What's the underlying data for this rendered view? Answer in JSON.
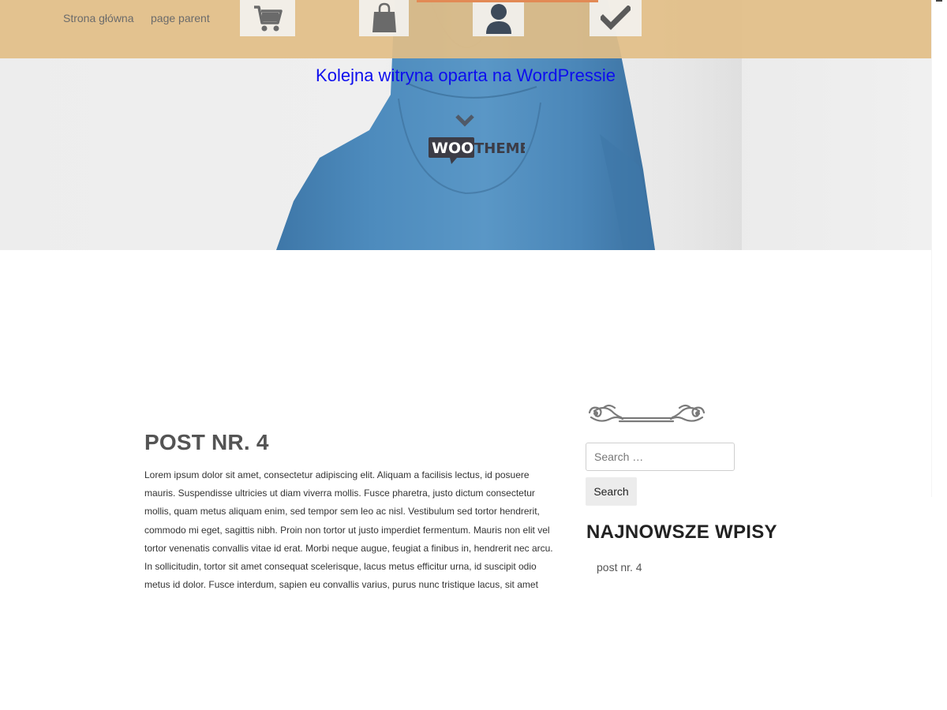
{
  "nav": {
    "links": [
      {
        "label": "Strona główna"
      },
      {
        "label": "page parent"
      }
    ],
    "icons": [
      {
        "name": "cart-icon"
      },
      {
        "name": "shopping-bag-icon"
      },
      {
        "name": "user-icon"
      },
      {
        "name": "checkmark-icon"
      }
    ]
  },
  "hero": {
    "tagline": "Kolejna witryna oparta na WordPressie",
    "logo_woo": "WOO",
    "logo_themes": "THEMES"
  },
  "post": {
    "title": "POST NR. 4",
    "body": "Lorem ipsum dolor sit amet, consectetur adipiscing elit. Aliquam a facilisis lectus, id posuere mauris. Suspendisse ultricies ut diam viverra mollis. Fusce pharetra, justo dictum consectetur mollis, quam metus aliquam enim, sed tempor sem leo ac nisl. Vestibulum sed tortor hendrerit, commodo mi eget, sagittis nibh. Proin non tortor ut justo imperdiet fermentum. Mauris non elit vel tortor venenatis convallis vitae id erat. Morbi neque augue, feugiat a finibus in, hendrerit nec arcu. In sollicitudin, tortor sit amet consequat scelerisque, lacus metus efficitur urna, id suscipit odio metus id dolor. Fusce interdum, sapien eu convallis varius, purus nunc tristique lacus, sit amet sagittis augue turpis a nisl."
  },
  "sidebar": {
    "search": {
      "placeholder": "Search …",
      "value": "",
      "button_label": "Search"
    },
    "recent_posts": {
      "title": "NAJNOWSZE WPISY",
      "items": [
        {
          "label": "post nr. 4"
        }
      ]
    }
  },
  "colors": {
    "topbar": "#e2be87",
    "tagline": "#0d0dee",
    "hoodie": "#4a86b8",
    "accent_strip": "#e28a55"
  }
}
